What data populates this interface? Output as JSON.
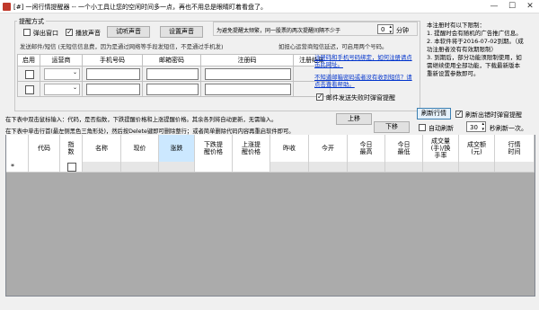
{
  "window": {
    "title": "[#] 一闲行情提醒器 -- 一个小工具让您的空闲时间多一点，再也不用总是眼睛盯着看盘了。",
    "minimize": "—",
    "maximize": "☐",
    "close": "✕"
  },
  "alert_mode": {
    "title": "提醒方式",
    "popup_label": "弹出窗口",
    "popup_checked": false,
    "sound_label": "播放声音",
    "sound_checked": true,
    "test_sound": "试听声音",
    "set_sound": "设置声音"
  },
  "interval": {
    "label": "为避免提醒太频繁，同一股票的两次提醒间隔不少于",
    "value": "0",
    "unit": "分钟"
  },
  "email": {
    "note": "发送邮件/短信 (无短信信息费，因为是通过网络等手段发短信，不是通过手机发)",
    "tip": "如担心运营商短信延迟，可启用两个号码。",
    "headers": [
      "启用",
      "运营商",
      "手机号码",
      "邮箱密码",
      "注册码",
      "注册结果"
    ],
    "link1": "注册码和手机号码绑定，如何注册请点击此网址。",
    "link2": "不知道邮箱密码或者没有收到短信？请点击查看帮助。",
    "fail_label": "邮件发送失败时弹窗提醒",
    "fail_checked": true
  },
  "notes": {
    "lines": [
      "本注册时有以下限制：",
      "1. 提醒时会有随机的广告推广信息。",
      "2. 本软件将于2016-07-02到期。（成",
      "功注册者没有有效期限制）",
      "3. 到期后，部分功能须限制使用，如",
      "需继续使用全部功能，下载最新版本",
      "重新设置参数即可。"
    ]
  },
  "instructions": {
    "line1": "在下表中双击鼠标输入：代码，是否指数，下跌提醒价格和上涨提醒价格。其余各列将自动更新，无需输入。",
    "line2": "在下表中单击行首(最左侧黑色三角形处)，然后按Delete键即可删除整行；或者简单删除代码内容再重启软件即可。"
  },
  "toolbar": {
    "move_up": "上移",
    "move_down": "下移",
    "refresh": "刷新行情",
    "refresh_flash_label": "刷新出错时弹窗提醒",
    "refresh_flash_checked": true,
    "auto_refresh_label": "自动刷新",
    "auto_refresh_checked": false,
    "auto_refresh_value": "30",
    "auto_refresh_unit": "秒刷新一次。"
  },
  "grid": {
    "columns": [
      "代码",
      "指数",
      "名称",
      "现价",
      "涨跌",
      "下跌提醒价格",
      "上涨提醒价格",
      "昨收",
      "今开",
      "今日最高",
      "今日最低",
      "成交量(手)/换手率",
      "成交额(元)",
      "行情时间"
    ],
    "new_row_marker": "*"
  }
}
